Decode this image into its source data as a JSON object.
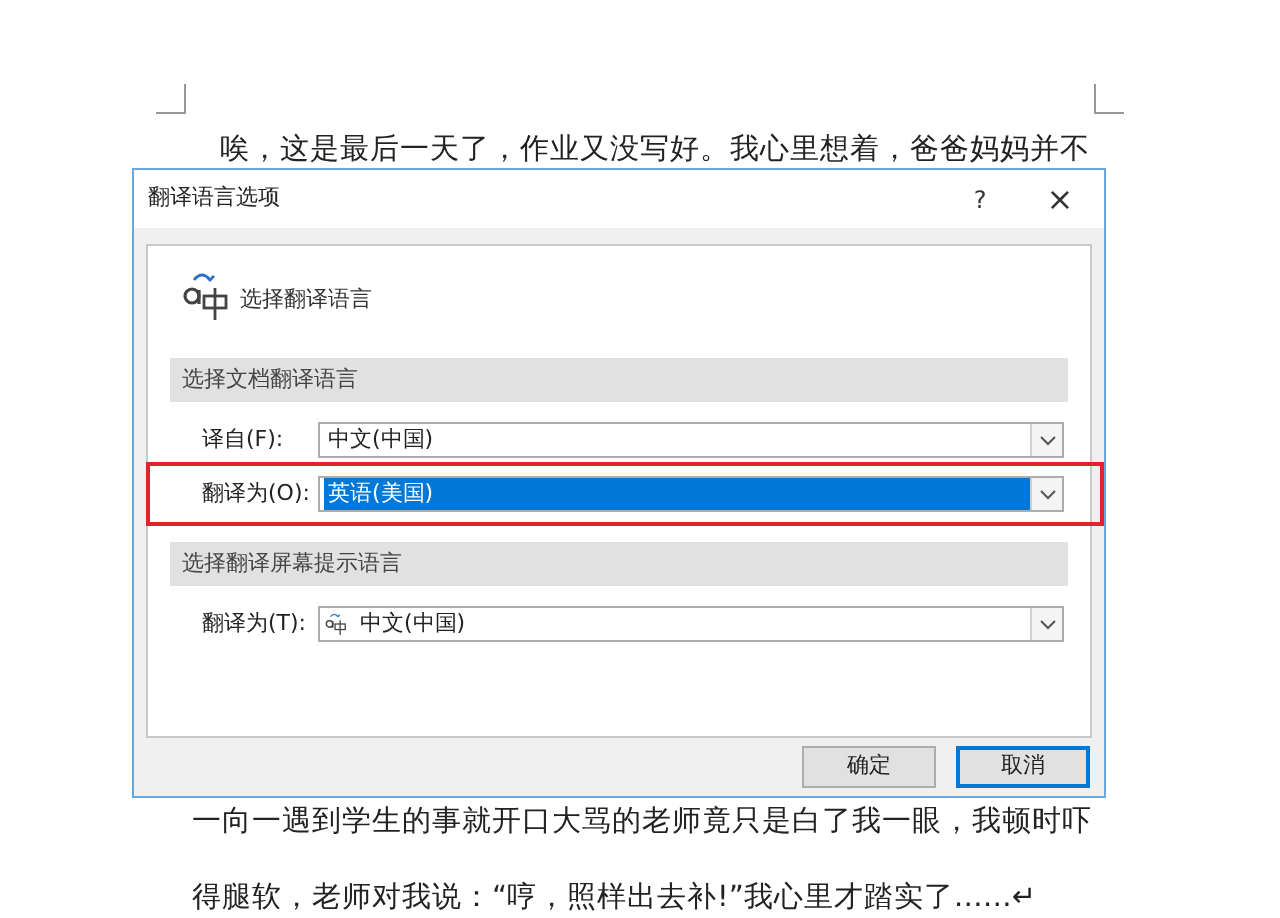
{
  "document": {
    "paragraphs": [
      "唉，这是最后一天了，作业又没写好。我心里想着，爸爸妈妈并不",
      "一向一遇到学生的事就开口大骂的老师竟只是白了我一眼，我顿时吓",
      "得腿软，老师对我说：“哼，照样出去补!”我心里才踏实了……↵"
    ]
  },
  "dialog": {
    "title": "翻译语言选项",
    "help": "?",
    "close": "×",
    "header": "选择翻译语言",
    "sections": [
      {
        "heading": "选择文档翻译语言",
        "rows": [
          {
            "label": "译自(F):",
            "value": "中文(中国)",
            "focused": false,
            "highlighted": false,
            "has_icon": false
          },
          {
            "label": "翻译为(O):",
            "value": "英语(美国)",
            "focused": true,
            "highlighted": true,
            "has_icon": false
          }
        ]
      },
      {
        "heading": "选择翻译屏幕提示语言",
        "rows": [
          {
            "label": "翻译为(T):",
            "value": "中文(中国)",
            "focused": false,
            "highlighted": false,
            "has_icon": true
          }
        ]
      }
    ],
    "buttons": [
      {
        "label": "确定",
        "default": false
      },
      {
        "label": "取消",
        "default": true
      }
    ]
  }
}
